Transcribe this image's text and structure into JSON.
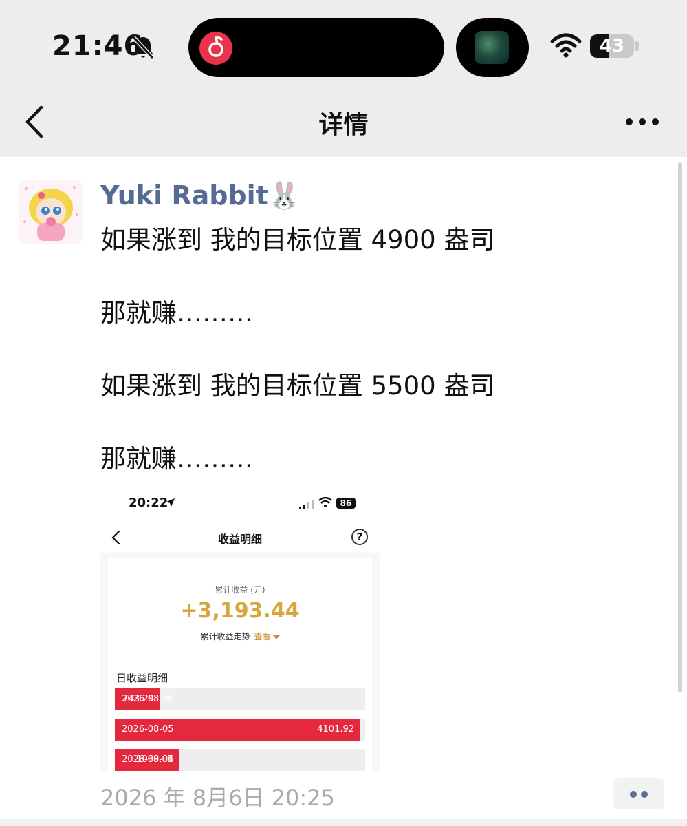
{
  "status_bar": {
    "time": "21:46",
    "battery": "43",
    "battery_level_percent": 43
  },
  "nav": {
    "title": "详情"
  },
  "post": {
    "author": "Yuki Rabbit🐰",
    "lines": [
      "如果涨到 我的目标位置 4900 盎司",
      "那就赚………",
      "如果涨到 我的目标位置 5500 盎司",
      "那就赚………"
    ],
    "timestamp": "2026 年 8月6日 20:25"
  },
  "embedded_screenshot": {
    "time": "20:22",
    "battery": "86",
    "title": "收益明细",
    "help": "?",
    "cumulative_label": "累计收益 (元)",
    "cumulative_value": "+3,193.44",
    "trend_label": "累计收益走势",
    "trend_link": "查看",
    "daily_title": "日收益明细",
    "daily_max": 4101.92,
    "daily": [
      {
        "date": "2026-08-06",
        "amount": "743.29",
        "value": 743.29
      },
      {
        "date": "2026-08-05",
        "amount": "4101.92",
        "value": 4101.92
      },
      {
        "date": "2026-08-04",
        "amount": "1069.05",
        "value": 1069.05
      }
    ]
  },
  "icons": {
    "back": "chevron-left-icon",
    "more": "more-dots-icon",
    "silent": "bell-slash-icon",
    "wifi": "wifi-icon",
    "comment": "comment-dots-icon"
  },
  "colors": {
    "author": "#566b94",
    "gain": "#d7a63a",
    "bar": "#e4293e",
    "music_app": "#e8344a"
  }
}
